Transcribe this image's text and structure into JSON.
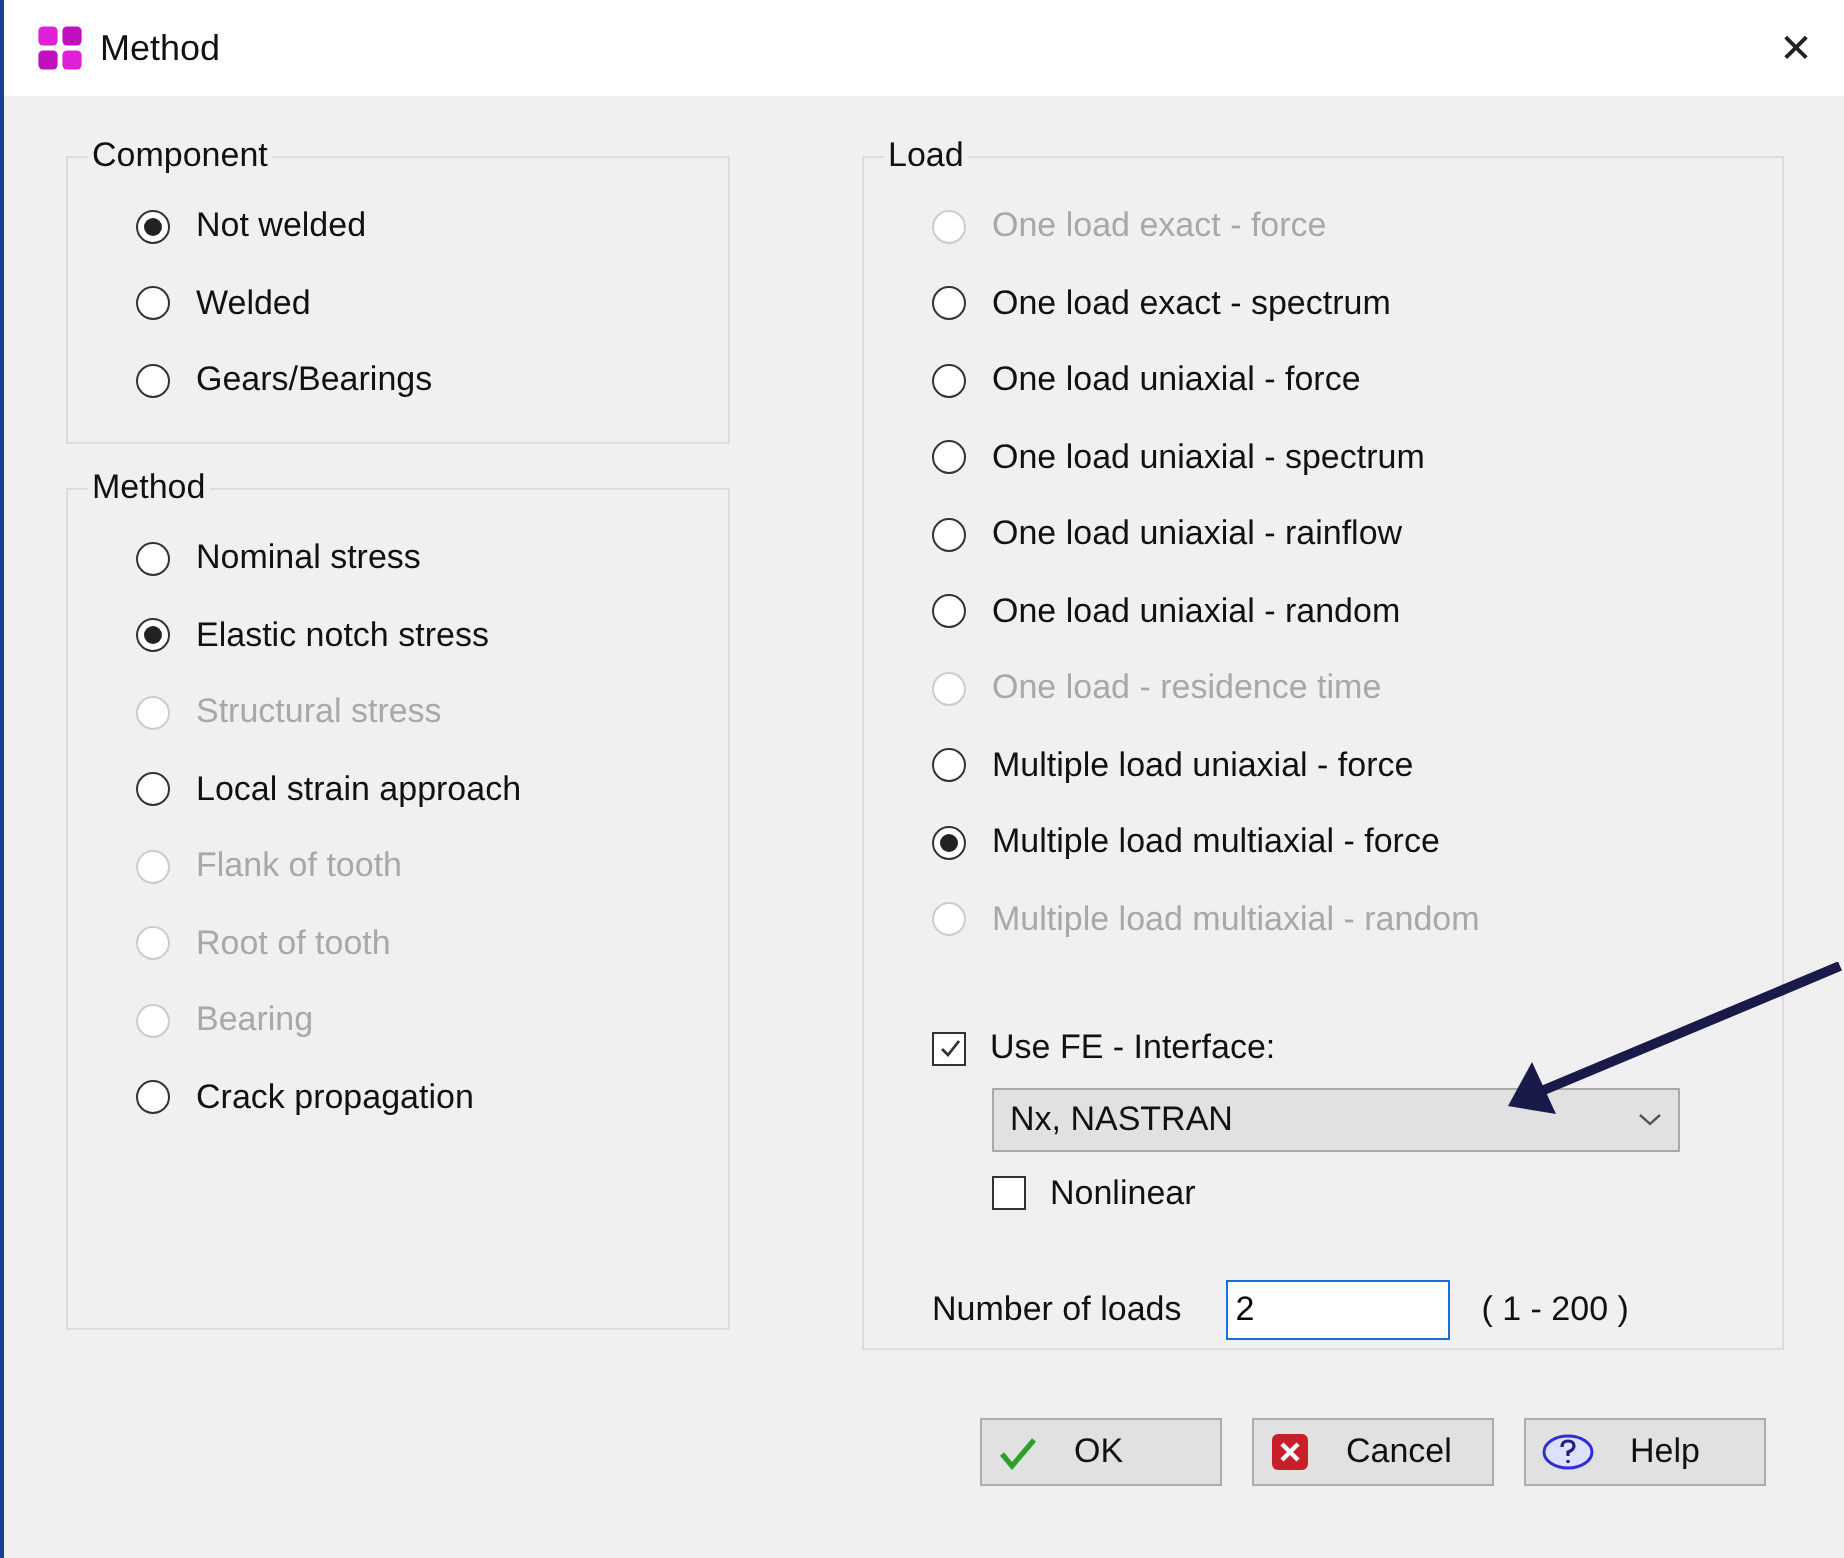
{
  "window": {
    "title": "Method",
    "close": "✕"
  },
  "component": {
    "title": "Component",
    "options": [
      {
        "label": "Not welded",
        "selected": true,
        "disabled": false
      },
      {
        "label": "Welded",
        "selected": false,
        "disabled": false
      },
      {
        "label": "Gears/Bearings",
        "selected": false,
        "disabled": false
      }
    ]
  },
  "method": {
    "title": "Method",
    "options": [
      {
        "label": "Nominal stress",
        "selected": false,
        "disabled": false
      },
      {
        "label": "Elastic notch stress",
        "selected": true,
        "disabled": false
      },
      {
        "label": "Structural stress",
        "selected": false,
        "disabled": true
      },
      {
        "label": "Local strain approach",
        "selected": false,
        "disabled": false
      },
      {
        "label": "Flank of tooth",
        "selected": false,
        "disabled": true
      },
      {
        "label": "Root of tooth",
        "selected": false,
        "disabled": true
      },
      {
        "label": "Bearing",
        "selected": false,
        "disabled": true
      },
      {
        "label": "Crack propagation",
        "selected": false,
        "disabled": false
      }
    ]
  },
  "load": {
    "title": "Load",
    "options": [
      {
        "label": "One load exact - force",
        "selected": false,
        "disabled": true
      },
      {
        "label": "One load exact - spectrum",
        "selected": false,
        "disabled": false
      },
      {
        "label": "One load uniaxial - force",
        "selected": false,
        "disabled": false
      },
      {
        "label": "One load uniaxial - spectrum",
        "selected": false,
        "disabled": false
      },
      {
        "label": "One load uniaxial - rainflow",
        "selected": false,
        "disabled": false
      },
      {
        "label": "One load uniaxial - random",
        "selected": false,
        "disabled": false
      },
      {
        "label": "One load - residence time",
        "selected": false,
        "disabled": true
      },
      {
        "label": "Multiple load uniaxial - force",
        "selected": false,
        "disabled": false
      },
      {
        "label": "Multiple load multiaxial - force",
        "selected": true,
        "disabled": false
      },
      {
        "label": "Multiple load multiaxial - random",
        "selected": false,
        "disabled": true
      }
    ],
    "fe_interface": {
      "label": "Use FE - Interface:",
      "checked": true
    },
    "solver": {
      "value": "Nx, NASTRAN"
    },
    "nonlinear": {
      "label": "Nonlinear",
      "checked": false
    },
    "number_of_loads": {
      "label": "Number of loads",
      "value": "2",
      "range": "( 1 - 200 )"
    }
  },
  "buttons": [
    {
      "label": "OK",
      "kind": "ok"
    },
    {
      "label": "Cancel",
      "kind": "cancel"
    },
    {
      "label": "Help",
      "kind": "help"
    }
  ]
}
